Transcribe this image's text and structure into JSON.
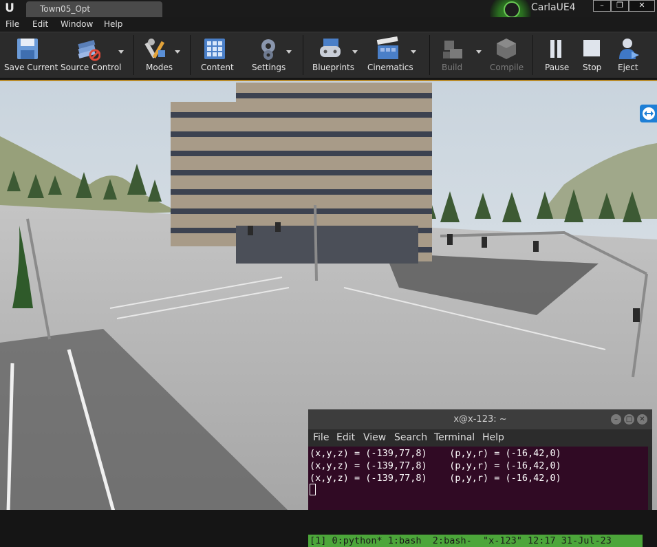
{
  "window": {
    "doc_tab": "Town05_Opt",
    "project_name": "CarlaUE4",
    "controls": [
      "minimize-icon",
      "restore-icon",
      "close-icon"
    ]
  },
  "menu": [
    "File",
    "Edit",
    "Window",
    "Help"
  ],
  "toolbar": {
    "save_current": "Save Current",
    "source_control": "Source Control",
    "modes": "Modes",
    "content": "Content",
    "settings": "Settings",
    "blueprints": "Blueprints",
    "cinematics": "Cinematics",
    "build": "Build",
    "compile": "Compile",
    "pause": "Pause",
    "stop": "Stop",
    "eject": "Eject"
  },
  "terminal": {
    "title": "x@x-123: ~",
    "menu": [
      "File",
      "Edit",
      "View",
      "Search",
      "Terminal",
      "Help"
    ],
    "lines": [
      "(x,y,z) = (-139,77,8)    (p,y,r) = (-16,42,0)",
      "(x,y,z) = (-139,77,8)    (p,y,r) = (-16,42,0)",
      "(x,y,z) = (-139,77,8)    (p,y,r) = (-16,42,0)"
    ],
    "tmux_status": "[1] 0:python* 1:bash  2:bash-  \"x-123\" 12:17 31-Jul-23"
  },
  "colors": {
    "accent_border": "#b98b2a",
    "project_glow": "#3b8f2e",
    "terminal_bg": "#300a24",
    "tmux_bar": "#4ca63a",
    "side_button": "#1e7fd6"
  }
}
